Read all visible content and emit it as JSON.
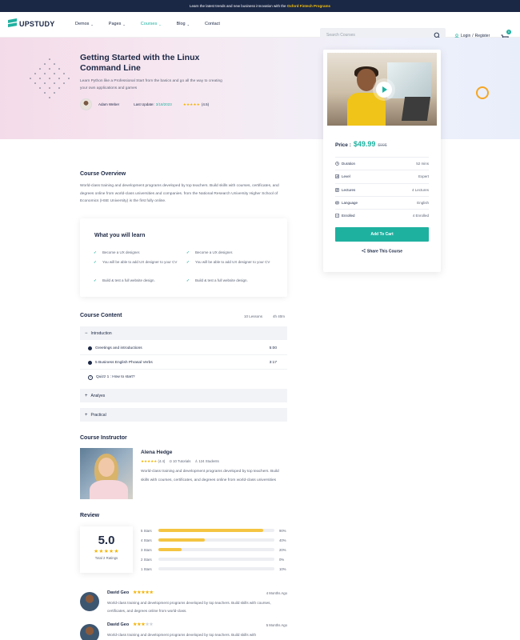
{
  "topbar": {
    "text": "Learn the latest trends and new business innovation with the ",
    "highlight": "Oxford Fintech Programs"
  },
  "nav": {
    "logo": "UPSTUDY",
    "menu": [
      {
        "label": "Demos",
        "caret": "⌄"
      },
      {
        "label": "Pages",
        "caret": "⌄"
      },
      {
        "label": "Courses",
        "caret": "⌄"
      },
      {
        "label": "Blog",
        "caret": "⌄"
      },
      {
        "label": "Contact",
        "caret": ""
      }
    ],
    "search_placeholder": "Search Courses",
    "login": "Login",
    "sep": "/",
    "register": "Register",
    "cart_count": "0"
  },
  "hero": {
    "title": "Getting Started with the Linux Command Line",
    "subtitle": "Learn Python like a Professional Start from the basics and go all the way to creating your own applications and games",
    "author": "Adam Weber",
    "last_update_label": "Last Update:",
    "last_update": "3/18/2023",
    "stars": "★★★★★",
    "rating": "(4.5)"
  },
  "card": {
    "price_label": "Price :",
    "price": "$49.99",
    "old_price": "$99$",
    "rows": [
      {
        "label": "Duration",
        "value": "52 mins",
        "icon": "clock-icon"
      },
      {
        "label": "Level",
        "value": "Expert",
        "icon": "level-icon"
      },
      {
        "label": "Lectures",
        "value": "4 Lectures",
        "icon": "lectures-icon"
      },
      {
        "label": "Language",
        "value": "English",
        "icon": "language-icon"
      },
      {
        "label": "Enrolled",
        "value": "4 Enrolled",
        "icon": "enrolled-icon"
      }
    ],
    "add_to_cart": "Add To Cart",
    "share": "Share This Course"
  },
  "overview": {
    "title": "Course Overview",
    "text": "World-class training and development programs developed by top teachers. Build skills with courses, certificates, and degrees online from world-class universities and companies. from the National Research University Higher School of Economics (HSE University) is the first fully online."
  },
  "learn": {
    "title": "What you will learn",
    "left": [
      "Become a UX designer.",
      "You will be able to add UX designer to your CV",
      "Build & test a full website design."
    ],
    "right": [
      "Become a UX designer.",
      "You will be able to add UX designer to your CV",
      "Build & test a full website design."
    ]
  },
  "content": {
    "title": "Course Content",
    "lessons_count": "10 Lessons",
    "duration": "4h 40m",
    "sections": [
      {
        "sym": "−",
        "label": "Introduction"
      },
      {
        "sym": "+",
        "label": "Analyes"
      },
      {
        "sym": "+",
        "label": "Practical"
      }
    ],
    "lessons": [
      {
        "label": "Greetings and introductions",
        "time": "5:00"
      },
      {
        "label": "5 Business English Phrasal Verbs",
        "time": "3:17"
      },
      {
        "label": "Quizz 1 : How to start?",
        "time": ""
      }
    ]
  },
  "instructor": {
    "title": "Course Instructor",
    "name": "Alena Hedge",
    "stars": "★★★★★",
    "rating": "(4.4)",
    "tutorials": "10 Tutorials",
    "students": "124 Students",
    "bio": "World-class training and development programs developed by top teachers. Build skills with courses, certificates, and degrees online from world-class universities"
  },
  "review": {
    "title": "Review",
    "score": "5.0",
    "stars": "★★★★★",
    "total": "Total 2 Ratings",
    "bars": [
      {
        "label": "5 Stars",
        "pct": "90%",
        "value": 0.9
      },
      {
        "label": "4 Stars",
        "pct": "40%",
        "value": 0.4
      },
      {
        "label": "3 Stars",
        "pct": "20%",
        "value": 0.2
      },
      {
        "label": "2 Stars",
        "pct": "0%",
        "value": 0
      },
      {
        "label": "1 Stars",
        "pct": "10%",
        "value": 0
      }
    ],
    "items": [
      {
        "name": "David Geo",
        "stars": "★★★★★",
        "stars_off": "",
        "time": "4 Months Ago",
        "text": "World-class training and development programs developed by top teachers. Build skills with courses, certificates, and degrees online from world-class."
      },
      {
        "name": "David Geo",
        "stars": "★★★",
        "stars_off": "★★",
        "time": "5 Months Ago",
        "text": "World-class training and development programs developed by top teachers. Build skills with"
      }
    ]
  },
  "colors": {
    "accent": "#1fb1a0",
    "navy": "#1a2745",
    "star": "#f5b301",
    "bar": "#f5c542"
  }
}
